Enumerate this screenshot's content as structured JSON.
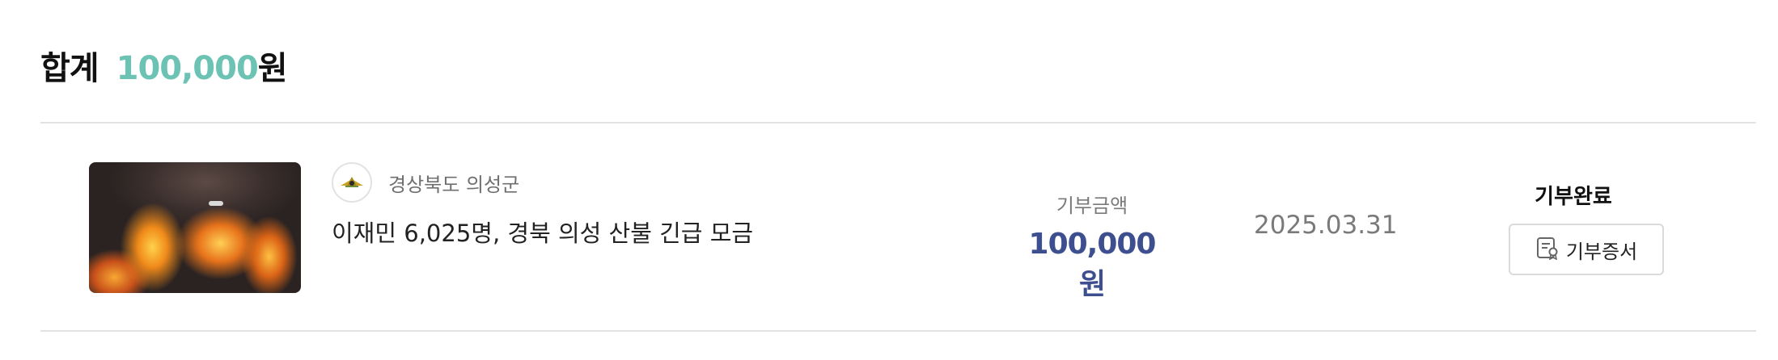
{
  "summary": {
    "label": "합계",
    "amount": "100,000",
    "unit": "원"
  },
  "donations": [
    {
      "thumbnail_icon": "wildfire-photo",
      "org_icon": "county-emblem-icon",
      "org_name": "경상북도 의성군",
      "title": "이재민 6,025명, 경북 의성 산불 긴급 모금",
      "amount_label": "기부금액",
      "amount_value": "100,000원",
      "date": "2025.03.31",
      "status": "기부완료",
      "certificate_icon": "certificate-icon",
      "certificate_label": "기부증서"
    }
  ],
  "colors": {
    "total_accent": "#6cc3b3",
    "amount_accent": "#3d4f8e",
    "divider": "#e2e2e2"
  }
}
